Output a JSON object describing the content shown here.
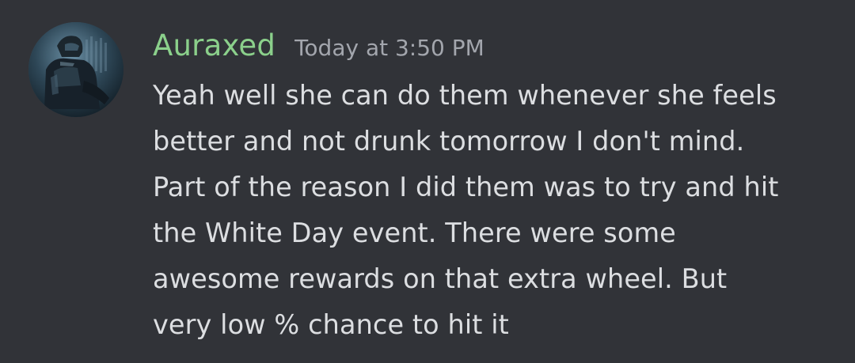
{
  "message": {
    "author": "Auraxed",
    "timestamp": "Today at 3:50 PM",
    "text": "Yeah well she can do them whenever she feels\nbetter and not drunk tomorrow I don't mind.\nPart of the reason I did them was to try and hit\nthe White Day event. There were some\nawesome rewards on that extra wheel. But\nvery low % chance to hit it",
    "avatar_icon": "armored-soldier-avatar"
  },
  "colors": {
    "background": "#313338",
    "username": "#8bd08b",
    "timestamp": "#a3a6ad",
    "text": "#dcdee1"
  }
}
